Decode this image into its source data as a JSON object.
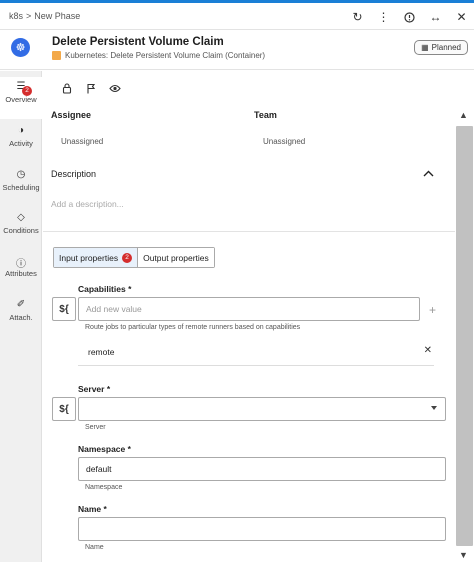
{
  "breadcrumb": {
    "root": "k8s",
    "separator": ">",
    "current": "New Phase"
  },
  "header": {
    "title": "Delete Persistent Volume Claim",
    "subtitle": "Kubernetes: Delete Persistent Volume Claim (Container)",
    "status": "Planned"
  },
  "sidebar": {
    "items": [
      {
        "label": "Overview",
        "icon": "list-icon",
        "badge": "2"
      },
      {
        "label": "Activity",
        "icon": "pie-icon"
      },
      {
        "label": "Scheduling",
        "icon": "clock-icon"
      },
      {
        "label": "Conditions",
        "icon": "diamond-icon"
      },
      {
        "label": "Attributes",
        "icon": "info-icon"
      },
      {
        "label": "Attach.",
        "icon": "paperclip-icon"
      }
    ]
  },
  "overview": {
    "assignee_label": "Assignee",
    "assignee_value": "Unassigned",
    "team_label": "Team",
    "team_value": "Unassigned",
    "description_label": "Description",
    "description_placeholder": "Add a description..."
  },
  "tabs": {
    "input_label": "Input properties",
    "input_badge": "2",
    "output_label": "Output properties"
  },
  "fields": {
    "capabilities": {
      "label": "Capabilities *",
      "placeholder": "Add new value",
      "hint": "Route jobs to particular types of remote runners based on capabilities",
      "values": [
        "remote"
      ]
    },
    "server": {
      "label": "Server *",
      "value": "",
      "hint": "Server"
    },
    "namespace": {
      "label": "Namespace *",
      "value": "default",
      "hint": "Namespace"
    },
    "name": {
      "label": "Name *",
      "value": "",
      "hint": "Name"
    },
    "variable_button": "${"
  },
  "colors": {
    "accent": "#1a7fd6",
    "badge": "#d42d2d",
    "sidebar": "#f0f0f0",
    "k8s": "#326ce5"
  }
}
